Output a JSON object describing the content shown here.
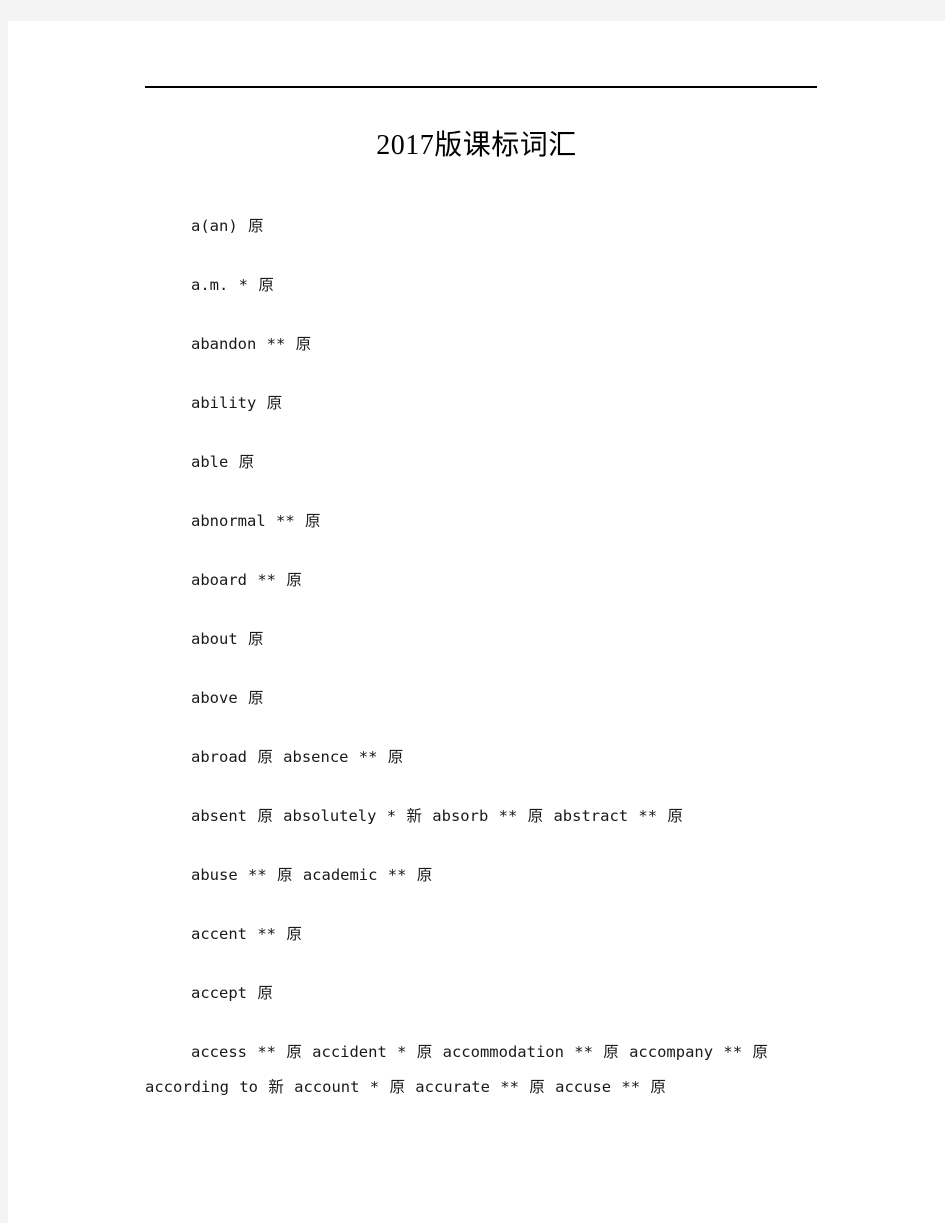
{
  "page": {
    "title": "2017版课标词汇",
    "background_color": "#ffffff",
    "canvas_color": "#f4f4f4",
    "rule_color": "#000000",
    "text_color": "#1a1a1a"
  },
  "entries": [
    {
      "text": "a(an) 原"
    },
    {
      "text": "a.m. * 原"
    },
    {
      "text": "abandon ** 原"
    },
    {
      "text": "ability 原"
    },
    {
      "text": "able 原"
    },
    {
      "text": "abnormal ** 原"
    },
    {
      "text": "aboard ** 原"
    },
    {
      "text": "about 原"
    },
    {
      "text": "above 原"
    },
    {
      "text": "abroad 原 absence ** 原"
    },
    {
      "text": "absent 原 absolutely * 新 absorb ** 原 abstract ** 原"
    },
    {
      "text": "abuse ** 原 academic ** 原"
    },
    {
      "text": "accent ** 原"
    },
    {
      "text": "accept 原"
    },
    {
      "text": "access ** 原 accident * 原 accommodation ** 原 accompany ** 原 according to 新 account * 原 accurate ** 原 accuse ** 原"
    }
  ]
}
